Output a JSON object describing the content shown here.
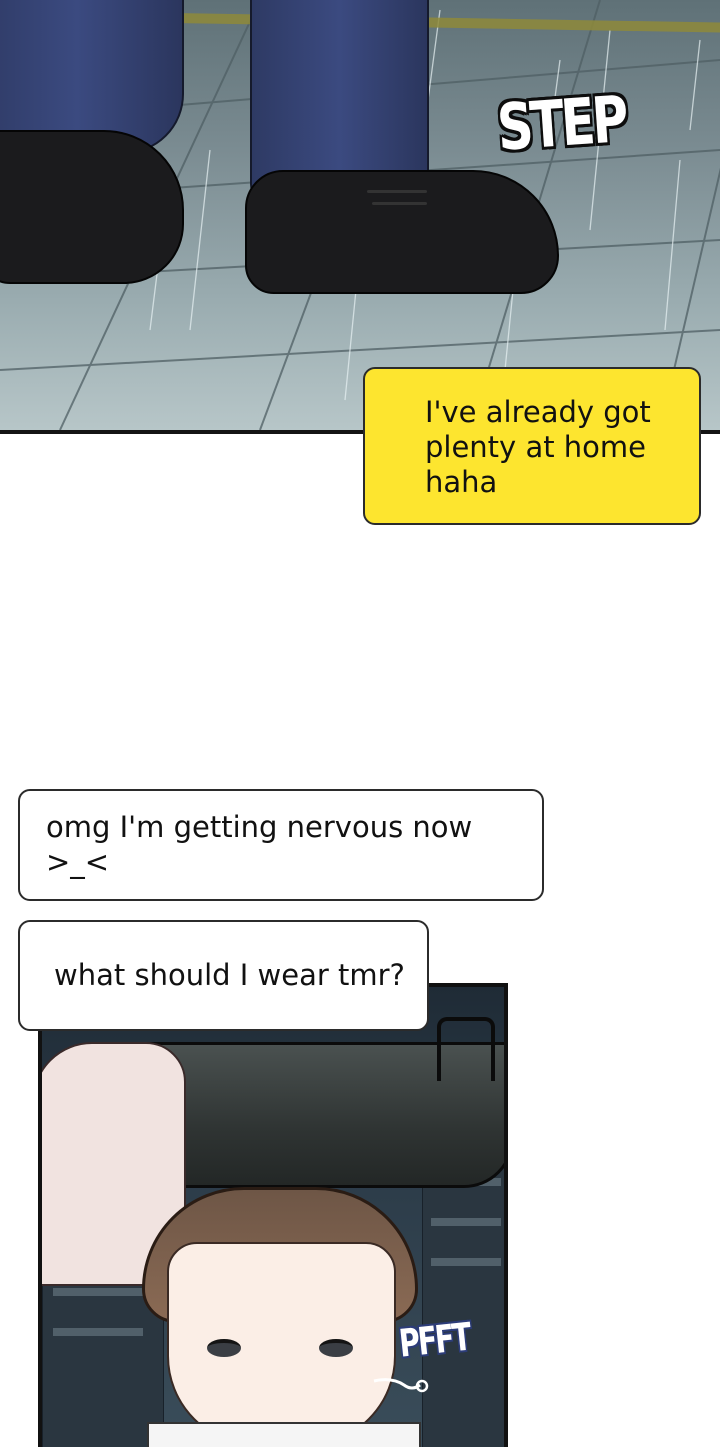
{
  "panel_top": {
    "sfx": "STEP"
  },
  "chat": {
    "yellow_bubble": {
      "lines": [
        "I've already got",
        "plenty at home",
        "haha"
      ]
    },
    "white_bubbles": [
      {
        "text": "omg I'm getting nervous now >_<"
      },
      {
        "text": "what should I wear tmr?"
      }
    ]
  },
  "panel_bottom": {
    "sfx": "PFFT"
  },
  "colors": {
    "yellow_bubble": "#fde52f",
    "white_bubble": "#ffffff",
    "bubble_border": "#2b2b2b",
    "trousers": "#3b4a80",
    "pavement": "#9aacb0"
  }
}
